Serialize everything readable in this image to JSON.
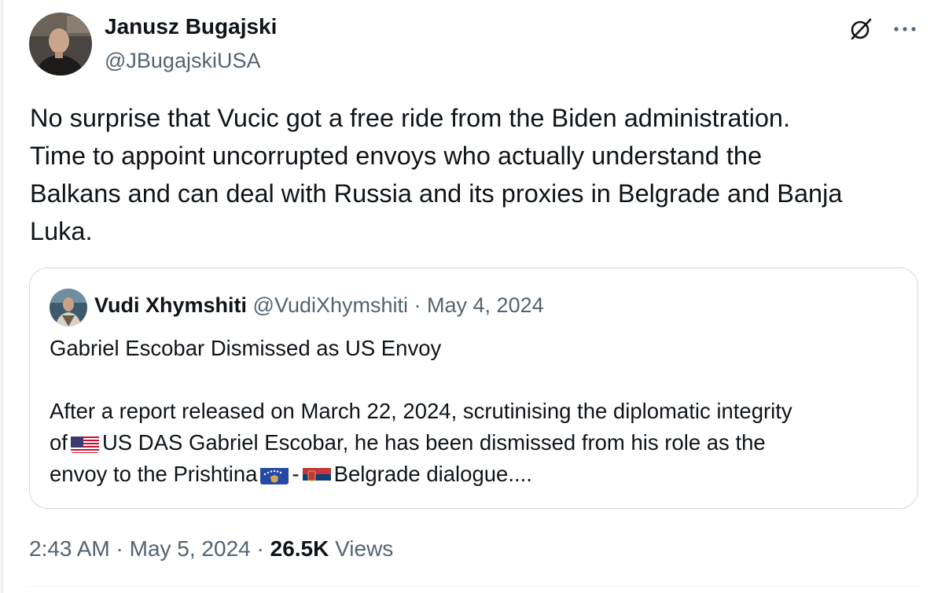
{
  "author": {
    "name": "Janusz Bugajski",
    "handle": "@JBugajskiUSA"
  },
  "tweet": {
    "lines": [
      "No surprise that Vucic got a free ride from the Biden administration.",
      "Time to appoint uncorrupted envoys who actually understand the",
      "Balkans and can deal with Russia and its proxies in Belgrade and Banja",
      "Luka."
    ]
  },
  "quote": {
    "name": "Vudi Xhymshiti",
    "handle": "@VudiXhymshiti",
    "separator": " · ",
    "date": "May 4, 2024",
    "title": "Gabriel Escobar Dismissed as US Envoy",
    "line1": "After a report released on March 22, 2024, scrutinising the diplomatic integrity",
    "line2_pre": "of",
    "line2_post": "US DAS Gabriel Escobar, he has been dismissed from his role as the",
    "line3_pre": "envoy to the Prishtina",
    "line3_dash": "-",
    "line3_post": "Belgrade dialogue...."
  },
  "footer": {
    "time": "2:43 AM",
    "sep1": " · ",
    "date": "May 5, 2024",
    "sep2": " · ",
    "views_count": "26.5K",
    "views_label": "Views"
  },
  "icons": {
    "grok": "grok-icon",
    "more": "more-options-icon",
    "flags": [
      "us-flag-icon",
      "kosovo-flag-icon",
      "serbia-flag-icon"
    ]
  },
  "colors": {
    "text": "#0f1419",
    "secondary": "#536471",
    "border": "#cfd9de"
  }
}
